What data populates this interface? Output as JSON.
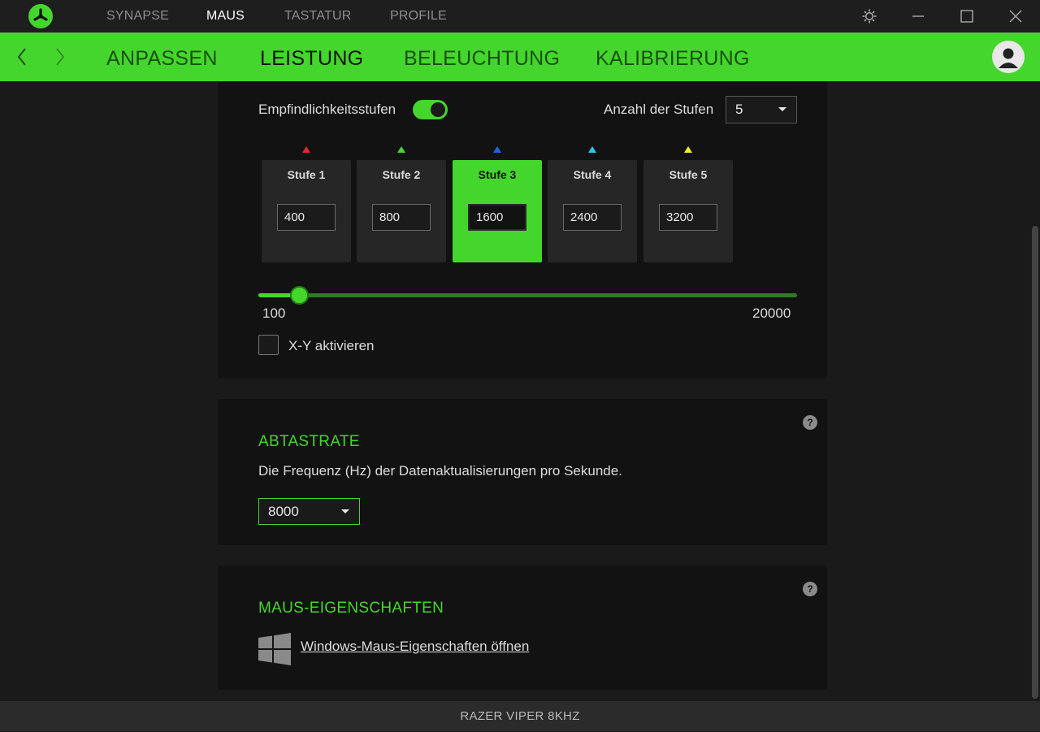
{
  "topnav": {
    "items": [
      {
        "label": "SYNAPSE",
        "active": false
      },
      {
        "label": "MAUS",
        "active": true
      },
      {
        "label": "TASTATUR",
        "active": false
      },
      {
        "label": "PROFILE",
        "active": false
      }
    ],
    "icons": [
      "settings-icon",
      "minimize-icon",
      "maximize-icon",
      "close-icon"
    ]
  },
  "subnav": {
    "tabs": [
      {
        "label": "ANPASSEN",
        "active": false
      },
      {
        "label": "LEISTUNG",
        "active": true
      },
      {
        "label": "BELEUCHTUNG",
        "active": false
      },
      {
        "label": "KALIBRIERUNG",
        "active": false
      }
    ]
  },
  "sensitivity": {
    "toggle_label": "Empfindlichkeitsstufen",
    "toggle_on": true,
    "count_label": "Anzahl der Stufen",
    "count_value": "5",
    "stages": [
      {
        "title": "Stufe 1",
        "value": "400",
        "color": "#e8262b"
      },
      {
        "title": "Stufe 2",
        "value": "800",
        "color": "#44d62c"
      },
      {
        "title": "Stufe 3",
        "value": "1600",
        "color": "#2162e8",
        "selected": true
      },
      {
        "title": "Stufe 4",
        "value": "2400",
        "color": "#23c9ef"
      },
      {
        "title": "Stufe 5",
        "value": "3200",
        "color": "#f2f21c"
      }
    ],
    "slider_min": "100",
    "slider_max": "20000",
    "slider_value": 1600,
    "xy_label": "X-Y aktivieren",
    "xy_checked": false
  },
  "polling": {
    "title": "ABTASTRATE",
    "description": "Die Frequenz (Hz) der Datenaktualisierungen pro Sekunde.",
    "value": "8000",
    "help": "?"
  },
  "mouse_props": {
    "title": "MAUS-EIGENSCHAFTEN",
    "link": "Windows-Maus-Eigenschaften öffnen",
    "help": "?"
  },
  "footer": {
    "device": "RAZER VIPER 8KHZ"
  },
  "colors": {
    "accent": "#44d62c",
    "background": "#1a1a1a",
    "card": "#121212"
  }
}
